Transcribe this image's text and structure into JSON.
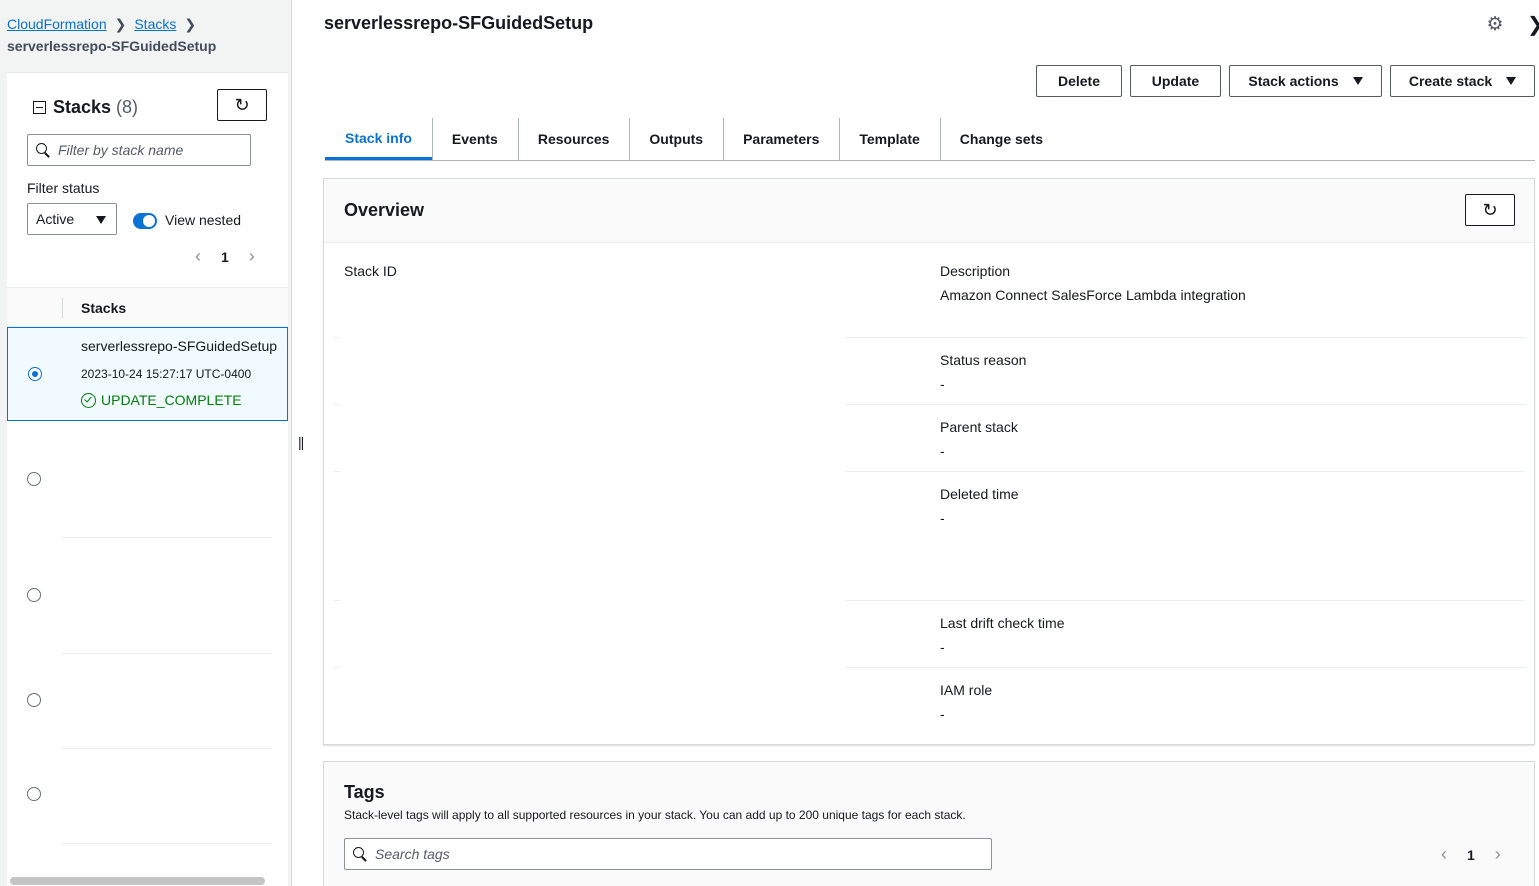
{
  "breadcrumb": {
    "items": [
      "CloudFormation",
      "Stacks"
    ],
    "current": "serverlessrepo-SFGuidedSetup"
  },
  "stacks_panel": {
    "title": "Stacks",
    "count": "(8)",
    "refresh_icon": "refresh-icon",
    "filter_placeholder": "Filter by stack name",
    "filter_status_label": "Filter status",
    "status_selected": "Active",
    "view_nested_label": "View nested",
    "view_nested_on": true,
    "page": "1",
    "column_header": "Stacks",
    "rows": [
      {
        "name": "serverlessrepo-SFGuidedSetup",
        "created": "2023-10-24 15:27:17 UTC-0400",
        "status": "UPDATE_COMPLETE",
        "selected": true
      },
      {
        "name": "",
        "created": "",
        "status": "",
        "selected": false
      },
      {
        "name": "",
        "created": "",
        "status": "",
        "selected": false
      },
      {
        "name": "",
        "created": "",
        "status": "",
        "selected": false
      },
      {
        "name": "",
        "created": "",
        "status": "",
        "selected": false
      }
    ]
  },
  "main": {
    "title": "serverlessrepo-SFGuidedSetup",
    "actions": {
      "delete": "Delete",
      "update": "Update",
      "stack_actions": "Stack actions",
      "create_stack": "Create stack"
    },
    "tabs": [
      "Stack info",
      "Events",
      "Resources",
      "Outputs",
      "Parameters",
      "Template",
      "Change sets"
    ],
    "active_tab": "Stack info",
    "overview": {
      "title": "Overview",
      "stack_id_label": "Stack ID",
      "fields": [
        {
          "label": "Description",
          "value": "Amazon Connect SalesForce Lambda integration"
        },
        {
          "label": "Status reason",
          "value": "-"
        },
        {
          "label": "Parent stack",
          "value": "-"
        },
        {
          "label": "Deleted time",
          "value": "-"
        },
        {
          "label": "Last drift check time",
          "value": "-"
        },
        {
          "label": "IAM role",
          "value": "-"
        }
      ]
    },
    "tags": {
      "title": "Tags",
      "description": "Stack-level tags will apply to all supported resources in your stack. You can add up to 200 unique tags for each stack.",
      "search_placeholder": "Search tags",
      "page": "1"
    }
  },
  "colors": {
    "link": "#0972d3",
    "success": "#037f0c",
    "border": "#d5dbdb"
  }
}
